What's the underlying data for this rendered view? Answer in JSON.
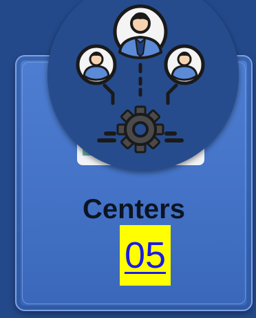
{
  "card": {
    "label": "Centers",
    "count": "05",
    "icon": "organization-network-icon"
  },
  "colors": {
    "background": "#24498b",
    "card": "#4a79cc",
    "circle": "#264c8d",
    "count_highlight": "#ffff00",
    "count_text": "#1a1ae8"
  }
}
